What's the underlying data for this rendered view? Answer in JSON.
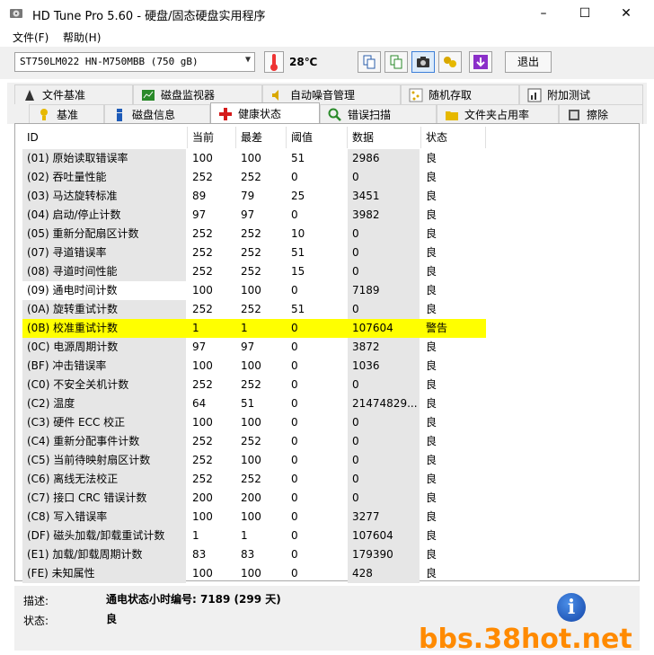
{
  "window": {
    "title": "HD Tune Pro 5.60 - 硬盘/固态硬盘实用程序",
    "minimize": "–",
    "maximize": "☐",
    "close": "✕"
  },
  "menu": {
    "file": "文件(F)",
    "help": "帮助(H)"
  },
  "toolbar": {
    "drive": "ST750LM022 HN-M750MBB (750 gB)",
    "temperature": "28℃",
    "exit_label": "退出"
  },
  "tabs_top": [
    "文件基准",
    "磁盘监视器",
    "自动噪音管理",
    "随机存取",
    "附加测试"
  ],
  "tabs_bottom": [
    "基准",
    "磁盘信息",
    "健康状态",
    "错误扫描",
    "文件夹占用率",
    "擦除"
  ],
  "table": {
    "headers": {
      "id": "ID",
      "current": "当前",
      "worst": "最差",
      "threshold": "阈值",
      "data": "数据",
      "status": "状态"
    },
    "rows": [
      {
        "id": "(01) 原始读取错误率",
        "cur": "100",
        "worst": "100",
        "thr": "51",
        "data": "2986",
        "st": "良"
      },
      {
        "id": "(02) 吞吐量性能",
        "cur": "252",
        "worst": "252",
        "thr": "0",
        "data": "0",
        "st": "良"
      },
      {
        "id": "(03) 马达旋转标准",
        "cur": "89",
        "worst": "79",
        "thr": "25",
        "data": "3451",
        "st": "良"
      },
      {
        "id": "(04) 启动/停止计数",
        "cur": "97",
        "worst": "97",
        "thr": "0",
        "data": "3982",
        "st": "良"
      },
      {
        "id": "(05) 重新分配扇区计数",
        "cur": "252",
        "worst": "252",
        "thr": "10",
        "data": "0",
        "st": "良"
      },
      {
        "id": "(07) 寻道错误率",
        "cur": "252",
        "worst": "252",
        "thr": "51",
        "data": "0",
        "st": "良"
      },
      {
        "id": "(08) 寻道时间性能",
        "cur": "252",
        "worst": "252",
        "thr": "15",
        "data": "0",
        "st": "良"
      },
      {
        "id": "(09) 通电时间计数",
        "cur": "100",
        "worst": "100",
        "thr": "0",
        "data": "7189",
        "st": "良"
      },
      {
        "id": "(0A) 旋转重试计数",
        "cur": "252",
        "worst": "252",
        "thr": "51",
        "data": "0",
        "st": "良"
      },
      {
        "id": "(0B) 校准重试计数",
        "cur": "1",
        "worst": "1",
        "thr": "0",
        "data": "107604",
        "st": "警告"
      },
      {
        "id": "(0C) 电源周期计数",
        "cur": "97",
        "worst": "97",
        "thr": "0",
        "data": "3872",
        "st": "良"
      },
      {
        "id": "(BF) 冲击错误率",
        "cur": "100",
        "worst": "100",
        "thr": "0",
        "data": "1036",
        "st": "良"
      },
      {
        "id": "(C0) 不安全关机计数",
        "cur": "252",
        "worst": "252",
        "thr": "0",
        "data": "0",
        "st": "良"
      },
      {
        "id": "(C2) 温度",
        "cur": "64",
        "worst": "51",
        "thr": "0",
        "data": "21474829...",
        "st": "良"
      },
      {
        "id": "(C3) 硬件 ECC 校正",
        "cur": "100",
        "worst": "100",
        "thr": "0",
        "data": "0",
        "st": "良"
      },
      {
        "id": "(C4) 重新分配事件计数",
        "cur": "252",
        "worst": "252",
        "thr": "0",
        "data": "0",
        "st": "良"
      },
      {
        "id": "(C5) 当前待映射扇区计数",
        "cur": "252",
        "worst": "100",
        "thr": "0",
        "data": "0",
        "st": "良"
      },
      {
        "id": "(C6) 离线无法校正",
        "cur": "252",
        "worst": "252",
        "thr": "0",
        "data": "0",
        "st": "良"
      },
      {
        "id": "(C7) 接口 CRC 错误计数",
        "cur": "200",
        "worst": "200",
        "thr": "0",
        "data": "0",
        "st": "良"
      },
      {
        "id": "(C8) 写入错误率",
        "cur": "100",
        "worst": "100",
        "thr": "0",
        "data": "3277",
        "st": "良"
      },
      {
        "id": "(DF) 磁头加载/卸载重试计数",
        "cur": "1",
        "worst": "1",
        "thr": "0",
        "data": "107604",
        "st": "良"
      },
      {
        "id": "(E1) 加载/卸载周期计数",
        "cur": "83",
        "worst": "83",
        "thr": "0",
        "data": "179390",
        "st": "良"
      },
      {
        "id": "(FE) 未知属性",
        "cur": "100",
        "worst": "100",
        "thr": "0",
        "data": "428",
        "st": "良"
      }
    ]
  },
  "info": {
    "desc_label": "描述:",
    "desc_value": "通电状态小时编号: 7189 (299 天)",
    "status_label": "状态:",
    "status_value": "良",
    "info_glyph": "i"
  },
  "watermark": "bbs.38hot.net",
  "colors": {
    "warn_row": "#ffff00",
    "watermark": "#ff8a00"
  }
}
